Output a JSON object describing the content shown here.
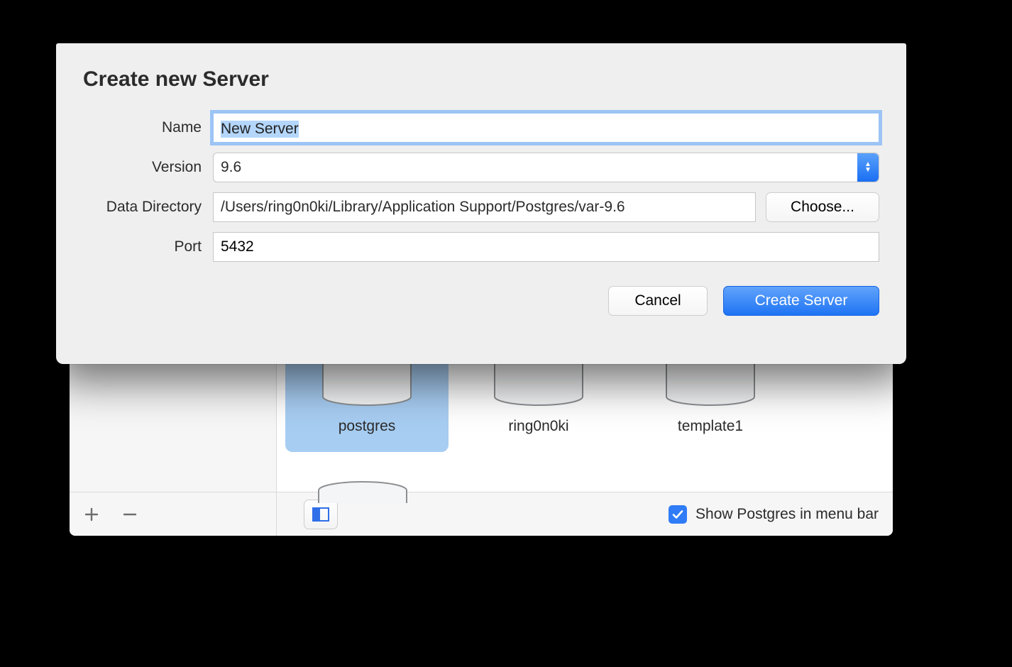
{
  "sheet": {
    "title": "Create new Server",
    "fields": {
      "name": {
        "label": "Name",
        "value": "New Server"
      },
      "version": {
        "label": "Version",
        "value": "9.6"
      },
      "data_directory": {
        "label": "Data Directory",
        "value": "/Users/ring0n0ki/Library/Application Support/Postgres/var-9.6",
        "button": "Choose..."
      },
      "port": {
        "label": "Port",
        "value": "5432"
      }
    },
    "buttons": {
      "cancel": "Cancel",
      "create": "Create Server"
    }
  },
  "databases": [
    {
      "name": "postgres",
      "selected": true
    },
    {
      "name": "ring0n0ki",
      "selected": false
    },
    {
      "name": "template1",
      "selected": false
    }
  ],
  "bottom": {
    "show_in_menu_bar_label": "Show Postgres in menu bar",
    "show_in_menu_bar_checked": true
  }
}
